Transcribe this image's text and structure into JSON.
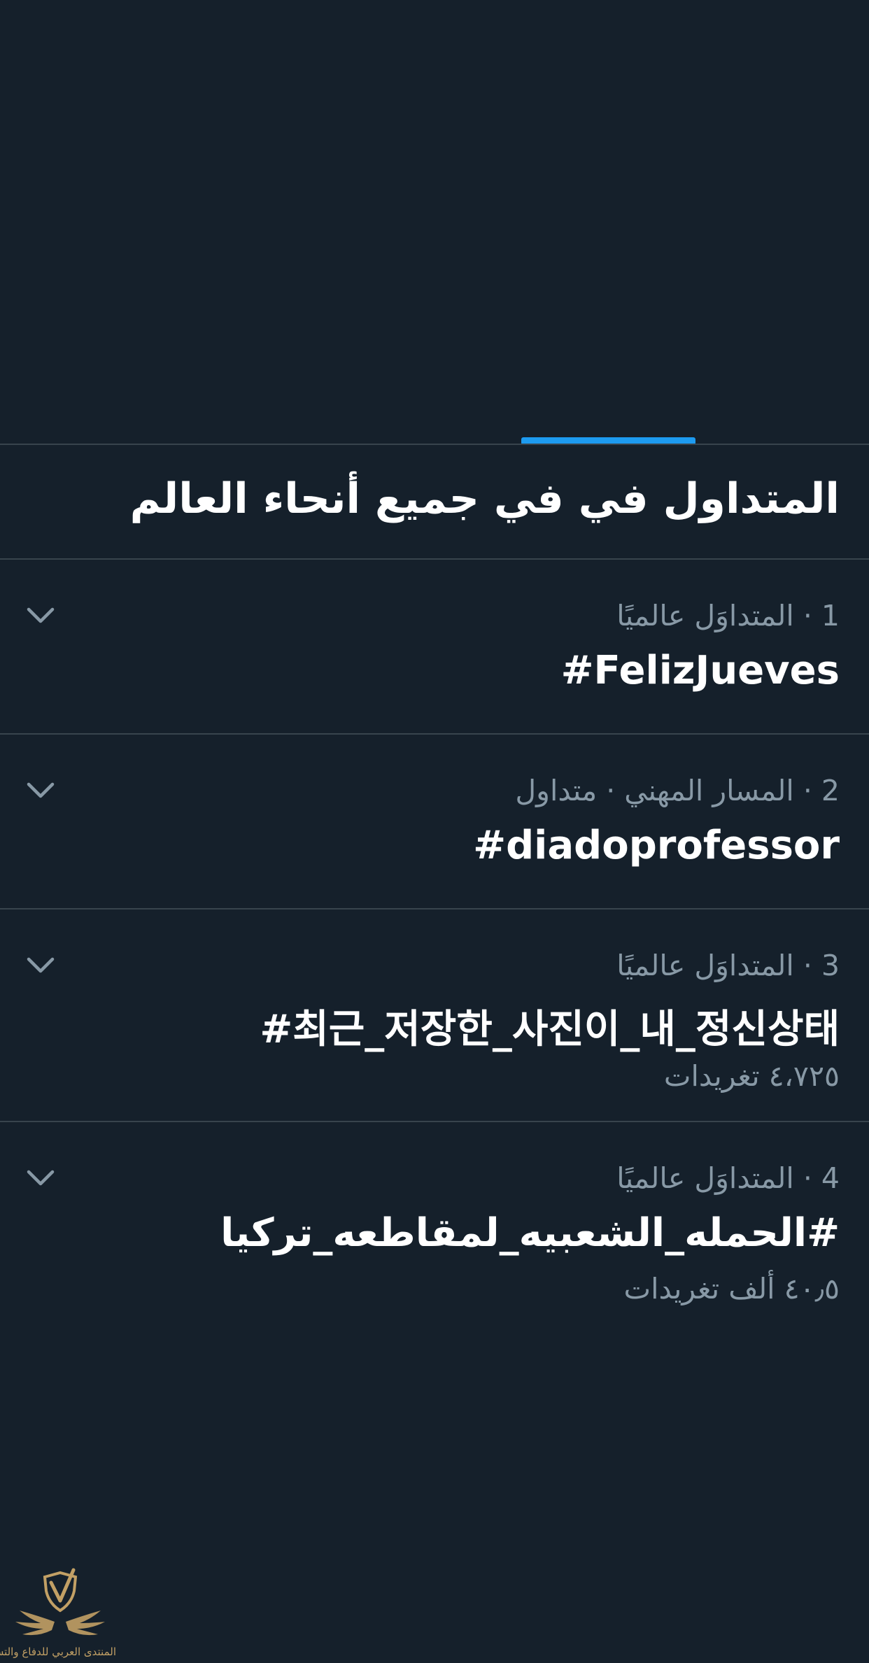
{
  "header": {
    "title": "المتداول في في جميع أنحاء العالم"
  },
  "trends": [
    {
      "meta": "1 · المتداوَل عالميًا",
      "name": "#FelizJueves",
      "count": ""
    },
    {
      "meta": "2 · المسار المهني · متداول",
      "name": "#diadoprofessor",
      "count": ""
    },
    {
      "meta": "3 · المتداوَل عالميًا",
      "name": "#최근_저장한_사진이_내_정신상태",
      "count": "٤،٧٢٥ تغريدات"
    },
    {
      "meta": "4 · المتداوَل عالميًا",
      "name": "#الحمله_الشعبيه_لمقاطعه_تركيا",
      "count": "٤٠٫٥ ألف تغريدات"
    }
  ],
  "watermark": {
    "text": "المنتدى العربي للدفاع والتسليح"
  },
  "icons": {
    "chevron": "chevron-down-icon",
    "logo": "shield-wings-logo"
  },
  "colors": {
    "background": "#15202b",
    "accent": "#1d9bf0",
    "divider": "#38444d",
    "secondary_text": "#8899a6",
    "watermark": "#c2a065"
  }
}
